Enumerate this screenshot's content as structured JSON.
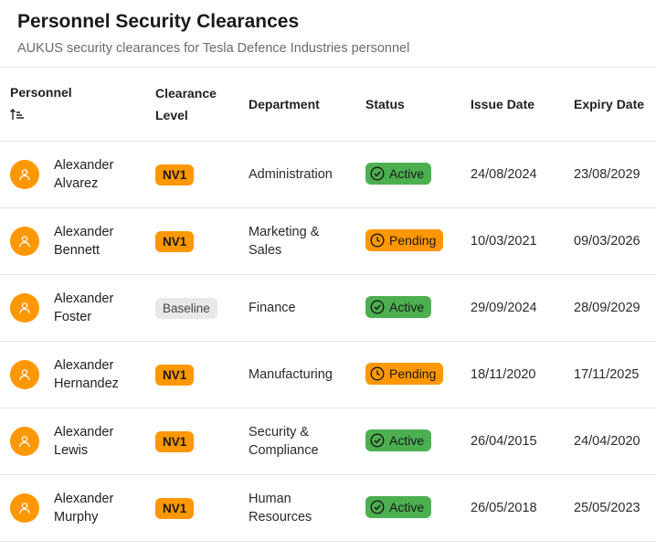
{
  "header": {
    "title": "Personnel Security Clearances",
    "subtitle": "AUKUS security clearances for Tesla Defence Industries personnel"
  },
  "columns": {
    "personnel": "Personnel",
    "clearance_level": [
      "Clearance",
      "Level"
    ],
    "department": "Department",
    "status": "Status",
    "issue_date": "Issue Date",
    "expiry_date": "Expiry Date"
  },
  "icons": {
    "sort": "sort-ascending-icon",
    "avatar": "person-icon",
    "active": "check-circle-icon",
    "pending": "clock-icon"
  },
  "colors": {
    "accent": "#ff9800",
    "active": "#4caf50",
    "baseline": "#e8e8e8"
  },
  "rows": [
    {
      "name": [
        "Alexander",
        "Alvarez"
      ],
      "level": "NV1",
      "department": [
        "Administration"
      ],
      "status": "Active",
      "issue": "24/08/2024",
      "expiry": "23/08/2029"
    },
    {
      "name": [
        "Alexander",
        "Bennett"
      ],
      "level": "NV1",
      "department": [
        "Marketing &",
        "Sales"
      ],
      "status": "Pending",
      "issue": "10/03/2021",
      "expiry": "09/03/2026"
    },
    {
      "name": [
        "Alexander",
        "Foster"
      ],
      "level": "Baseline",
      "department": [
        "Finance"
      ],
      "status": "Active",
      "issue": "29/09/2024",
      "expiry": "28/09/2029"
    },
    {
      "name": [
        "Alexander",
        "Hernandez"
      ],
      "level": "NV1",
      "department": [
        "Manufacturing"
      ],
      "status": "Pending",
      "issue": "18/11/2020",
      "expiry": "17/11/2025"
    },
    {
      "name": [
        "Alexander",
        "Lewis"
      ],
      "level": "NV1",
      "department": [
        "Security &",
        "Compliance"
      ],
      "status": "Active",
      "issue": "26/04/2015",
      "expiry": "24/04/2020"
    },
    {
      "name": [
        "Alexander",
        "Murphy"
      ],
      "level": "NV1",
      "department": [
        "Human",
        "Resources"
      ],
      "status": "Active",
      "issue": "26/05/2018",
      "expiry": "25/05/2023"
    }
  ]
}
